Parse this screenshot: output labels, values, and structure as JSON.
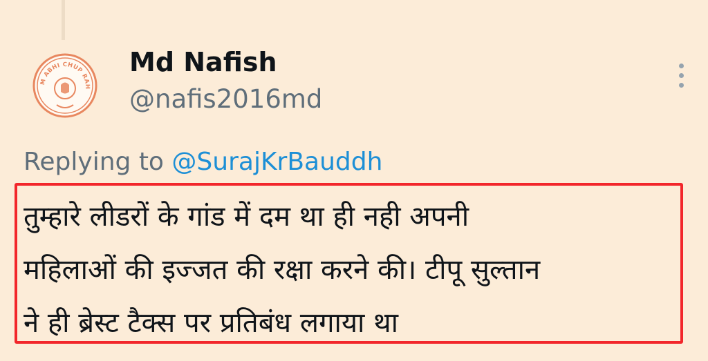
{
  "tweet": {
    "display_name": "Md Nafish",
    "handle": "@nafis2016md",
    "avatar": {
      "icon": "avatar-logo-icon",
      "ring_text": "TUM ABHI CHUP RAHO",
      "accent_color": "#e8875f"
    },
    "replying_label": "Replying to",
    "replying_to": "@SurajKrBauddh",
    "text_lines": [
      "तुम्हारे लीडरों के गांड में दम था ही नही अपनी",
      "महिलाओं की इज्जत की रक्षा करने की।  टीपू सुल्तान",
      "ने ही ब्रेस्ट टैक्स पर प्रतिबंध लगाया था"
    ]
  },
  "colors": {
    "background": "#fcecd8",
    "highlight_border": "#f2262b",
    "mention": "#1d8fd6",
    "muted_text": "#5f6e7a"
  }
}
